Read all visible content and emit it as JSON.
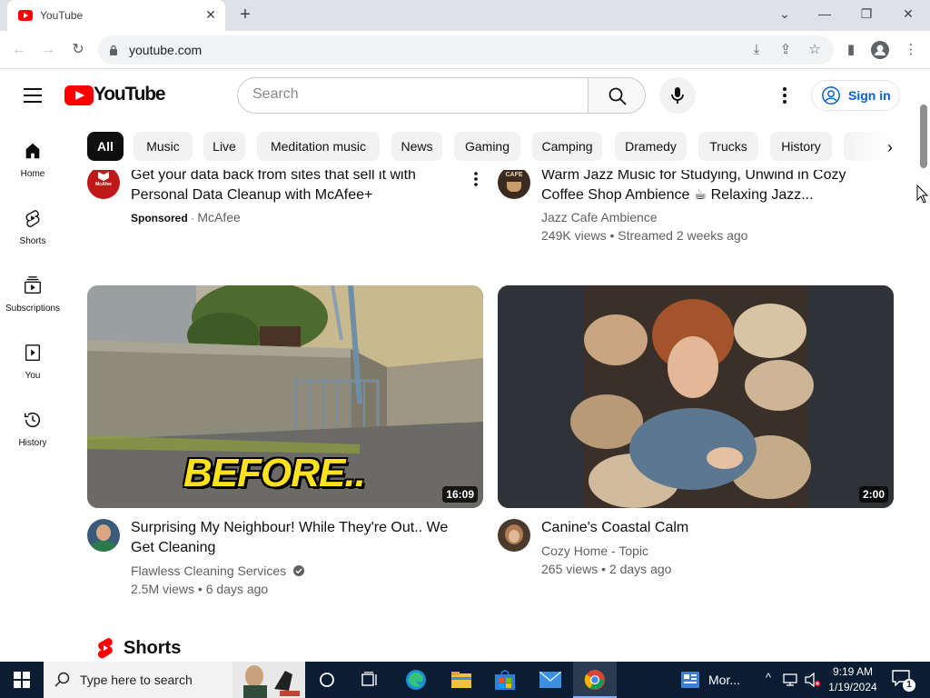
{
  "browser": {
    "tab_title": "YouTube",
    "url": "youtube.com"
  },
  "masthead": {
    "logo_text": "YouTube",
    "search_placeholder": "Search",
    "signin_label": "Sign in"
  },
  "guide": {
    "items": [
      {
        "label": "Home",
        "icon": "home-icon"
      },
      {
        "label": "Shorts",
        "icon": "shorts-icon"
      },
      {
        "label": "Subscriptions",
        "icon": "subscriptions-icon"
      },
      {
        "label": "You",
        "icon": "you-icon"
      },
      {
        "label": "History",
        "icon": "history-icon"
      }
    ]
  },
  "chips": [
    {
      "label": "All",
      "active": true
    },
    {
      "label": "Music"
    },
    {
      "label": "Live"
    },
    {
      "label": "Meditation music"
    },
    {
      "label": "News"
    },
    {
      "label": "Gaming"
    },
    {
      "label": "Camping"
    },
    {
      "label": "Dramedy"
    },
    {
      "label": "Trucks"
    },
    {
      "label": "History"
    }
  ],
  "feed": {
    "ad": {
      "title_line1": "Get your data back from sites that sell it with",
      "title_line2": "Personal Data Cleanup with McAfee+",
      "sponsored_label": "Sponsored",
      "separator": "·",
      "advertiser": "McAfee",
      "avatar_text": "McAfee"
    },
    "video_top_right": {
      "title_line1": "Warm Jazz Music for Studying, Unwind in Cozy",
      "title_line2": "Coffee Shop Ambience ☕ Relaxing Jazz...",
      "channel": "Jazz Cafe Ambience",
      "meta": "249K views • Streamed 2 weeks ago",
      "avatar_text": "CAFE"
    },
    "video_left": {
      "title_line1": "Surprising My Neighbour! While They're Out.. We",
      "title_line2": "Get Cleaning",
      "channel": "Flawless Cleaning Services",
      "meta": "2.5M views • 6 days ago",
      "duration": "16:09",
      "overlay_text": "BEFORE.."
    },
    "video_right": {
      "title": "Canine's Coastal Calm",
      "channel": "Cozy Home - Topic",
      "meta": "265 views • 2 days ago",
      "duration": "2:00"
    },
    "shorts_heading": "Shorts"
  },
  "taskbar": {
    "search_text": "Type here to search",
    "tray_app": "Mor...",
    "time": "9:19 AM",
    "date": "1/19/2024",
    "notification_count": "1"
  }
}
